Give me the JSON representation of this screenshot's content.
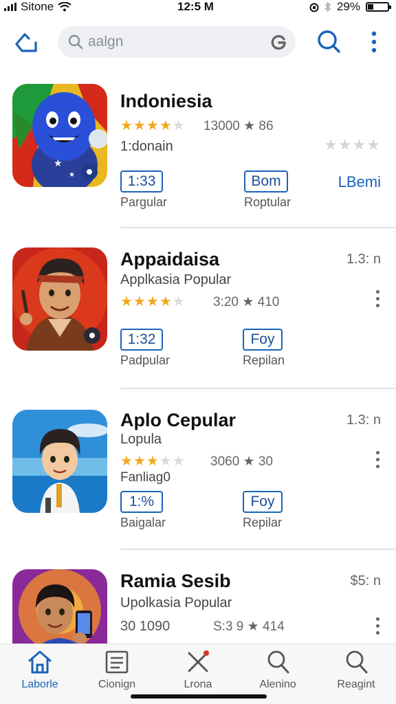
{
  "status": {
    "carrier": "Sitone",
    "time": "12:5 M",
    "battery": "29%",
    "battery_level": 0.29
  },
  "search": {
    "placeholder": "aalgn"
  },
  "apps": [
    {
      "name": "Indoniesia",
      "subtitle": "1:donain",
      "rating": 4,
      "count": "13000 ★ 86",
      "side_text": "",
      "pill_left": "1:33",
      "pill_left_label": "Pargular",
      "pill_right": "Bom",
      "pill_right_label": "Roptular",
      "link": "LBemi",
      "icon": "blue-mascot-icon"
    },
    {
      "name": "Appaidaisa",
      "subtitle": "Applkasia Popular",
      "rating": 4,
      "count": "3:20 ★ 410",
      "side_text": "1.3: n",
      "pill_left": "1:32",
      "pill_left_label": "Padpular",
      "pill_right": "Foy",
      "pill_right_label": "Repilan",
      "icon": "man-portrait-icon"
    },
    {
      "name": "Aplo Cepular",
      "subtitle": "Lopula",
      "rating": 3,
      "count": "3060 ★ 30",
      "side_text": "1.3: n",
      "extra": "Fanliag0",
      "pill_left": "1:%",
      "pill_left_label": "Baigalar",
      "pill_right": "Foy",
      "pill_right_label": "Repilar",
      "icon": "boy-beach-icon"
    },
    {
      "name": "Ramia Sesib",
      "subtitle": "Upolkasia Popular",
      "count_left": "30 1090",
      "count": "S:3 9 ★ 414",
      "side_text": "$5: n",
      "icon": "man-phone-icon"
    }
  ],
  "nav": [
    {
      "label": "Laborle",
      "icon": "home-icon"
    },
    {
      "label": "Cionign",
      "icon": "document-icon"
    },
    {
      "label": "Lrona",
      "icon": "crossed-tools-icon"
    },
    {
      "label": "Alenino",
      "icon": "search-icon"
    },
    {
      "label": "Reagint",
      "icon": "search-icon"
    }
  ],
  "colors": {
    "accent": "#1a63b8",
    "star": "#f2a71b"
  }
}
